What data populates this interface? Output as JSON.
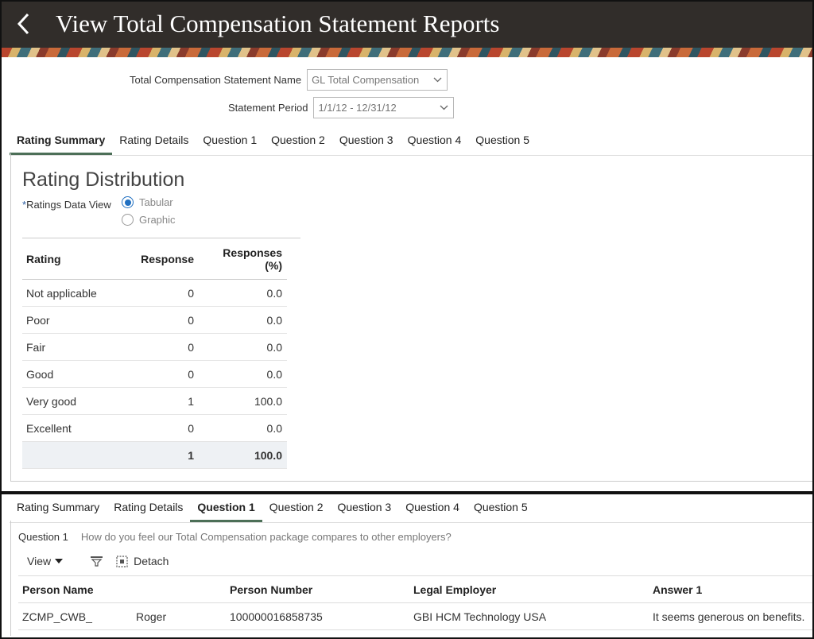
{
  "header": {
    "title": "View Total Compensation Statement Reports",
    "back_icon": "chevron-left-icon"
  },
  "form": {
    "statement_name_label": "Total Compensation Statement Name",
    "statement_name_value": "GL Total Compensation",
    "statement_period_label": "Statement Period",
    "statement_period_value": "1/1/12 - 12/31/12"
  },
  "tabs_top": [
    "Rating Summary",
    "Rating Details",
    "Question 1",
    "Question 2",
    "Question 3",
    "Question 4",
    "Question 5"
  ],
  "tabs_bottom": [
    "Rating Summary",
    "Rating Details",
    "Question 1",
    "Question 2",
    "Question 3",
    "Question 4",
    "Question 5"
  ],
  "rating": {
    "title": "Rating Distribution",
    "required_mark": "*",
    "data_view_label": "Ratings Data View",
    "options": [
      "Tabular",
      "Graphic"
    ],
    "selected_option": "Tabular",
    "columns": [
      "Rating",
      "Response",
      "Responses",
      "(%)"
    ],
    "rows": [
      [
        "Not applicable",
        "0",
        "0.0"
      ],
      [
        "Poor",
        "0",
        "0.0"
      ],
      [
        "Fair",
        "0",
        "0.0"
      ],
      [
        "Good",
        "0",
        "0.0"
      ],
      [
        "Very good",
        "1",
        "100.0"
      ],
      [
        "Excellent",
        "0",
        "0.0"
      ]
    ],
    "total": [
      "",
      "1",
      "100.0"
    ]
  },
  "question": {
    "label": "Question 1",
    "text": "How do you feel our Total Compensation package compares to other employers?",
    "toolbar": {
      "view_label": "View",
      "detach_label": "Detach"
    },
    "columns": [
      "Person Name",
      "Person Number",
      "Legal Employer",
      "Answer 1"
    ],
    "rows": [
      {
        "last_name": "ZCMP_CWB_",
        "first_name": "Roger",
        "number": "100000016858735",
        "employer": "GBI HCM Technology USA",
        "answer": "It seems generous on benefits."
      }
    ]
  },
  "colors": {
    "header_bg": "#312d2a",
    "tab_active": "#4c6f57",
    "radio_selected": "#1f6fc1"
  }
}
